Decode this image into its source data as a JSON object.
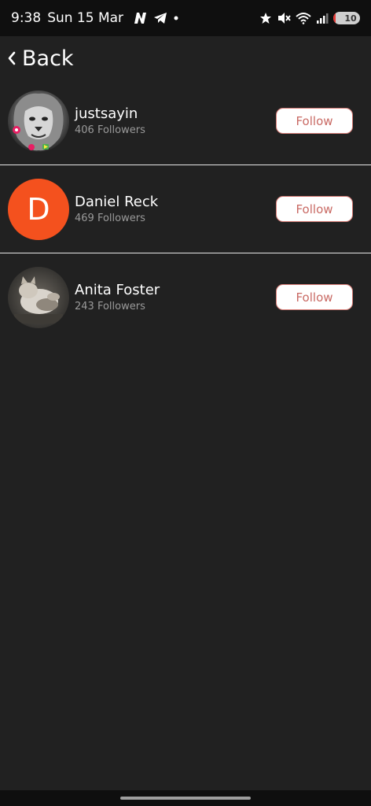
{
  "status_bar": {
    "time": "9:38",
    "date": "Sun 15 Mar",
    "battery_level": "10",
    "battery_fraction": 0.1,
    "icons": [
      "netflix-n-icon",
      "telegram-icon",
      "dot-icon",
      "star-icon",
      "mute-icon",
      "wifi-icon",
      "signal-icon",
      "battery-icon"
    ]
  },
  "header": {
    "back_label": "Back"
  },
  "users": [
    {
      "name": "justsayin",
      "followers": "406 Followers",
      "follow_label": "Follow",
      "avatar": "lion-photo"
    },
    {
      "name": "Daniel Reck",
      "followers": "469 Followers",
      "follow_label": "Follow",
      "avatar_letter": "D",
      "avatar_color": "#f4511e"
    },
    {
      "name": "Anita Foster",
      "followers": "243 Followers",
      "follow_label": "Follow",
      "avatar": "cat-photo"
    }
  ],
  "colors": {
    "background": "#212121",
    "follow_border": "#d47a74",
    "follow_text": "#c96a64"
  }
}
